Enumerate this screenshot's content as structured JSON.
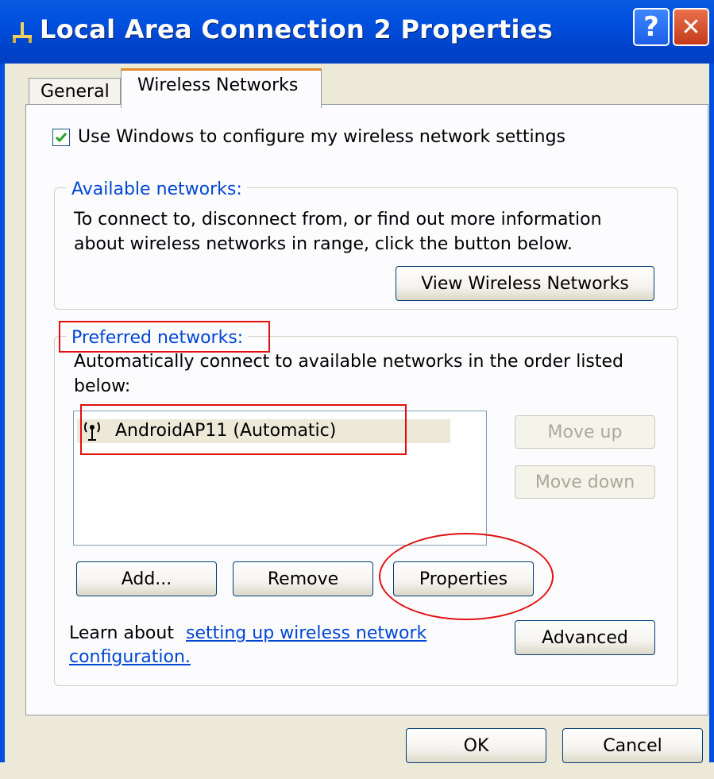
{
  "window": {
    "title": "Local Area Connection 2 Properties",
    "help_label": "?",
    "close_label": "✕",
    "title_bar_color": "#0050e0"
  },
  "tabs": [
    {
      "label": "General",
      "selected": false
    },
    {
      "label": "Wireless Networks",
      "selected": true
    }
  ],
  "wireless": {
    "use_windows_label": "Use Windows to configure my wireless network settings",
    "use_windows_checked": true,
    "available": {
      "legend": "Available networks:",
      "description_line1": "To connect to, disconnect from, or find out more information",
      "description_line2": "about wireless networks in range, click the button below.",
      "view_button": "View Wireless Networks"
    },
    "preferred": {
      "legend": "Preferred networks:",
      "description_line1": "Automatically connect to available networks in the order listed",
      "description_line2": "below:",
      "networks": [
        {
          "label": "AndroidAP11 (Automatic)",
          "icon": "wireless-antenna-icon"
        }
      ],
      "move_up": "Move up",
      "move_down": "Move down",
      "add": "Add...",
      "remove": "Remove",
      "properties": "Properties"
    },
    "learn_prefix": "Learn about ",
    "learn_link_line1": "setting up wireless network",
    "learn_link_line2": "configuration.",
    "advanced": "Advanced"
  },
  "footer": {
    "ok": "OK",
    "cancel": "Cancel"
  },
  "colors": {
    "accent_link": "#0046d5",
    "annotation": "#e01010",
    "tab_highlight": "#e68b2c"
  }
}
